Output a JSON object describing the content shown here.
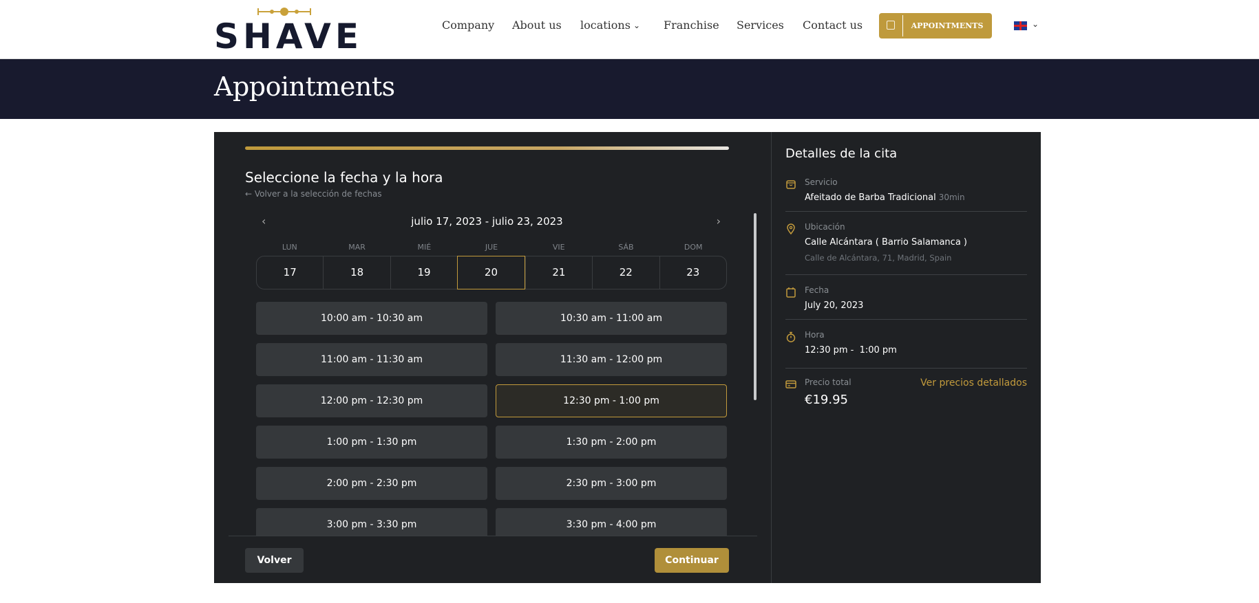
{
  "header": {
    "logo": "SHAVE",
    "nav": [
      {
        "label": "Company"
      },
      {
        "label": "About us"
      },
      {
        "label": "locations"
      },
      {
        "label": "Franchise"
      },
      {
        "label": "Services"
      },
      {
        "label": "Contact us"
      }
    ],
    "appointments_button": "APPOINTMENTS",
    "language": "en-GB"
  },
  "banner": {
    "title": "Appointments"
  },
  "booking": {
    "title": "Seleccione la fecha y la hora",
    "back_link": "Volver a la selección de fechas",
    "progress_percent": 100,
    "week_range": "julio 17, 2023 - julio 23, 2023",
    "day_names": [
      "LUN",
      "MAR",
      "MIÉ",
      "JUE",
      "VIE",
      "SÁB",
      "DOM"
    ],
    "days": [
      "17",
      "18",
      "19",
      "20",
      "21",
      "22",
      "23"
    ],
    "selected_day": "20",
    "slots": [
      "10:00 am - 10:30 am",
      "10:30 am - 11:00 am",
      "11:00 am - 11:30 am",
      "11:30 am - 12:00 pm",
      "12:00 pm - 12:30 pm",
      "12:30 pm - 1:00 pm",
      "1:00 pm - 1:30 pm",
      "1:30 pm - 2:00 pm",
      "2:00 pm - 2:30 pm",
      "2:30 pm - 3:00 pm",
      "3:00 pm - 3:30 pm",
      "3:30 pm - 4:00 pm"
    ],
    "selected_slot": "12:30 pm - 1:00 pm",
    "back_button": "Volver",
    "continue_button": "Continuar"
  },
  "details": {
    "title": "Detalles de la cita",
    "service_label": "Servicio",
    "service": "Afeitado de Barba Tradicional",
    "duration": "30min",
    "location_label": "Ubicación",
    "location": "Calle Alcántara ( Barrio Salamanca )",
    "address": "Calle de Alcántara, 71, Madrid, Spain",
    "date_label": "Fecha",
    "date": "July 20, 2023",
    "time_label": "Hora",
    "time": "12:30 pm -  1:00 pm",
    "price_label": "Precio total",
    "price": "€19.95",
    "price_link": "Ver precios detallados"
  },
  "colors": {
    "accent": "#bf9a3c",
    "banner": "#181a2e",
    "panel": "#1f2124",
    "slot": "#35383b"
  }
}
